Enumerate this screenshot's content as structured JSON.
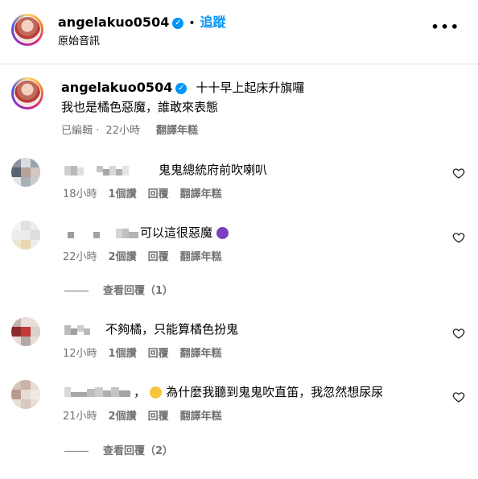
{
  "post": {
    "username": "angelakuo0504",
    "follow_label": "追蹤",
    "subtitle": "原始音訊",
    "more_icon": "more-icon"
  },
  "caption": {
    "username": "angelakuo0504",
    "line1": "十十早上起床升旗囉",
    "line2": "我也是橘色惡魔，誰敢來表態",
    "edited": "已編輯",
    "time": "22小時",
    "translate": "翻譯年糕"
  },
  "comments": [
    {
      "text": "鬼鬼總統府前吹喇叭",
      "time": "18小時",
      "likes": "1個讚",
      "reply": "回覆",
      "translate": "翻譯年糕"
    },
    {
      "text": "可以這很惡魔",
      "emoji": "devil-emoji",
      "time": "22小時",
      "likes": "2個讚",
      "reply": "回覆",
      "translate": "翻譯年糕",
      "view_replies": "查看回覆（1）"
    },
    {
      "text": "不夠橘，只能算橘色扮鬼",
      "time": "12小時",
      "likes": "1個讚",
      "reply": "回覆",
      "translate": "翻譯年糕"
    },
    {
      "prefix": "，",
      "text": "為什麼我聽到鬼鬼吹直笛，我忽然想尿尿",
      "emoji": "grinning-emoji",
      "time": "21小時",
      "likes": "2個讚",
      "reply": "回覆",
      "translate": "翻譯年糕",
      "view_replies": "查看回覆（2）"
    }
  ],
  "colors": {
    "accent": "#0095f6",
    "muted": "#737373",
    "divider": "#dbdbdb"
  }
}
